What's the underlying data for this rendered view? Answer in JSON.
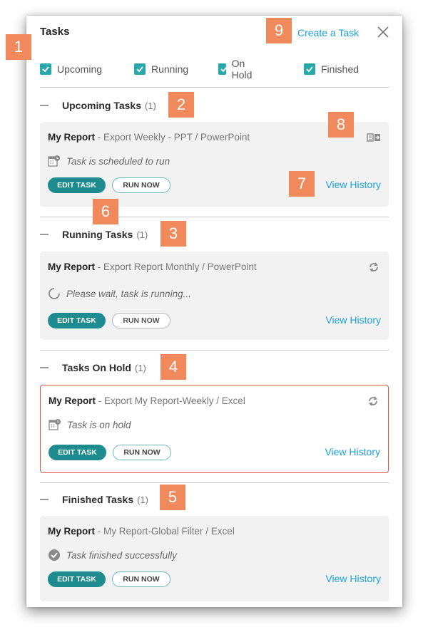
{
  "header": {
    "title": "Tasks",
    "create_link": "Create a Task"
  },
  "filters": [
    {
      "label": "Upcoming",
      "checked": true
    },
    {
      "label": "Running",
      "checked": true
    },
    {
      "label": "On Hold",
      "checked": true
    },
    {
      "label": "Finished",
      "checked": true
    }
  ],
  "badges": [
    "1",
    "2",
    "3",
    "4",
    "5",
    "6",
    "7",
    "8",
    "9"
  ],
  "sections": [
    {
      "title": "Upcoming Tasks",
      "count": "(1)",
      "card": {
        "name": "My Report",
        "detail": "  -  Export Weekly - PPT  /  PowerPoint",
        "status": "Task is scheduled to run",
        "edit": "EDIT TASK",
        "run": "RUN NOW",
        "history": "View History",
        "state": "upcoming"
      }
    },
    {
      "title": "Running Tasks",
      "count": "(1)",
      "card": {
        "name": "My Report",
        "detail": "  -  Export Report Monthly  /  PowerPoint",
        "status": "Please wait, task is running...",
        "edit": "EDIT TASK",
        "run": "RUN NOW",
        "history": "View History",
        "state": "running"
      }
    },
    {
      "title": "Tasks On Hold",
      "count": "(1)",
      "card": {
        "name": "My Report",
        "detail": "  -  Export My Report-Weekly  /  Excel",
        "status": "Task is on hold",
        "edit": "EDIT TASK",
        "run": "RUN NOW",
        "history": "View History",
        "state": "hold"
      }
    },
    {
      "title": "Finished Tasks",
      "count": "(1)",
      "card": {
        "name": "My Report",
        "detail": "  -  My Report-Global Filter  /  Excel",
        "status": "Task finished successfully",
        "edit": "EDIT TASK",
        "run": "RUN NOW",
        "history": "View History",
        "state": "finished"
      }
    }
  ],
  "colors": {
    "accent": "#1e8c8f",
    "link": "#1aa3d9",
    "hold_border": "#e05a4b",
    "badge": "#f08a5d"
  }
}
